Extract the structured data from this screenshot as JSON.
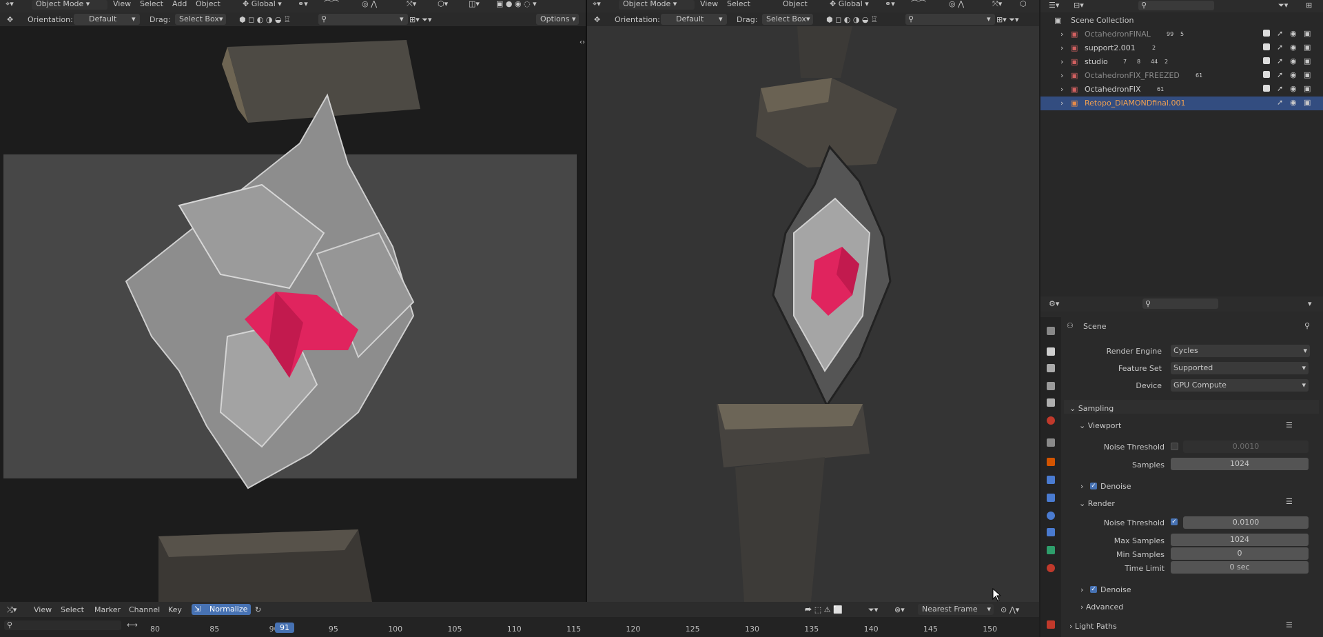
{
  "left_view": {
    "mode": "Object Mode",
    "menu": [
      "View",
      "Select",
      "Add",
      "Object"
    ],
    "transform_space": "Global",
    "orientation_label": "Orientation:",
    "orientation_value": "Default",
    "drag_label": "Drag:",
    "drag_value": "Select Box",
    "options": "Options"
  },
  "right_view": {
    "mode": "Object Mode",
    "menu": [
      "View",
      "Select",
      "Object"
    ],
    "transform_space": "Global",
    "orientation_label": "Orientation:",
    "orientation_value": "Default",
    "drag_label": "Drag:",
    "drag_value": "Select Box"
  },
  "outliner": {
    "root": "Scene Collection",
    "items": [
      {
        "name": "OctahedronFINAL",
        "badges": [
          "99",
          "5"
        ],
        "active": false,
        "dim": true
      },
      {
        "name": "support2.001",
        "badges": [
          "2"
        ],
        "active": false,
        "dim": false
      },
      {
        "name": "studio",
        "badges": [
          "7",
          "8",
          "44",
          "2"
        ],
        "active": false,
        "dim": false
      },
      {
        "name": "OctahedronFIX_FREEZED",
        "badges": [
          "61"
        ],
        "active": false,
        "dim": true
      },
      {
        "name": "OctahedronFIX",
        "badges": [
          "61"
        ],
        "active": false,
        "dim": false
      },
      {
        "name": "Retopo_DIAMONDfinal.001",
        "badges": [],
        "active": true,
        "dim": false
      }
    ]
  },
  "properties": {
    "context": "Scene",
    "render_engine_label": "Render Engine",
    "render_engine": "Cycles",
    "feature_set_label": "Feature Set",
    "feature_set": "Supported",
    "device_label": "Device",
    "device": "GPU Compute",
    "sampling": "Sampling",
    "viewport": "Viewport",
    "vp_noise_label": "Noise Threshold",
    "vp_noise": "0.0010",
    "vp_samples_label": "Samples",
    "vp_samples": "1024",
    "denoise": "Denoise",
    "render": "Render",
    "r_noise_label": "Noise Threshold",
    "r_noise": "0.0100",
    "max_samples_label": "Max Samples",
    "max_samples": "1024",
    "min_samples_label": "Min Samples",
    "min_samples": "0",
    "time_limit_label": "Time Limit",
    "time_limit": "0 sec",
    "denoise2": "Denoise",
    "advanced": "Advanced",
    "light_paths": "Light Paths"
  },
  "timeline": {
    "menu": [
      "View",
      "Select",
      "Marker",
      "Channel",
      "Key"
    ],
    "normalize": "Normalize",
    "snap": "Nearest Frame",
    "current_frame": "91",
    "ruler": [
      "80",
      "85",
      "90",
      "95",
      "100",
      "105",
      "110",
      "115",
      "120",
      "125",
      "130",
      "135",
      "140",
      "145",
      "150"
    ]
  },
  "colors": {
    "accent": "#4772b3",
    "gem": "#e0245e",
    "active_row": "#334d80"
  }
}
